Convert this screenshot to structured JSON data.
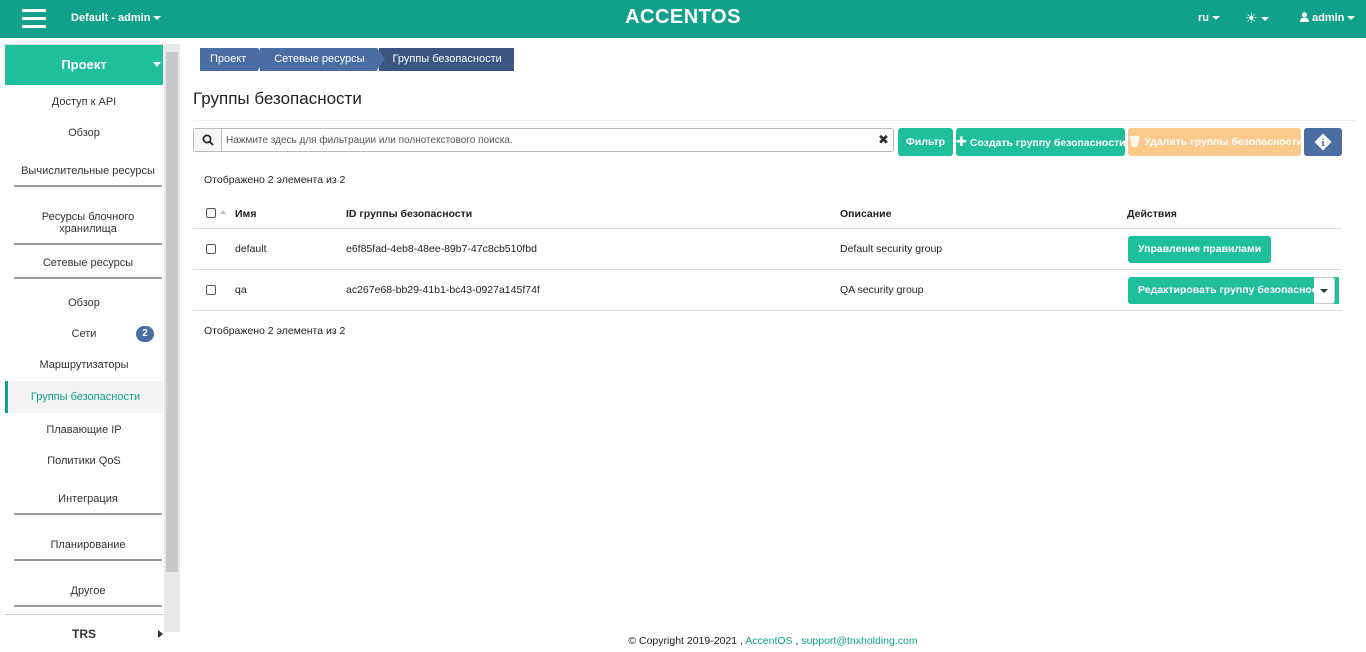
{
  "topbar": {
    "project_switch": "Default - admin",
    "logo": "ACCENTOS",
    "lang": "ru",
    "user": "admin"
  },
  "sidebar": {
    "project_header": "Проект",
    "api_access": "Доступ к API",
    "overview": "Обзор",
    "compute": "Вычислительные ресурсы",
    "block_storage": "Ресурсы блочного хранилища",
    "network": "Сетевые ресурсы",
    "network_items": {
      "overview": "Обзор",
      "networks": "Сети",
      "networks_badge": "2",
      "routers": "Маршрутизаторы",
      "security_groups": "Группы безопасности",
      "floating_ips": "Плавающие IP",
      "qos_policies": "Политики QoS"
    },
    "integration": "Интеграция",
    "planning": "Планирование",
    "other": "Другое",
    "trs": "TRS"
  },
  "breadcrumb": [
    "Проект",
    "Сетевые ресурсы",
    "Группы безопасности"
  ],
  "page_title": "Группы безопасности",
  "search": {
    "placeholder": "Нажмите здесь для фильтрации или полнотекстового поиска.",
    "clear": "✖"
  },
  "toolbar": {
    "filter": "Фильтр",
    "create": "Создать группу безопасности",
    "delete": "Удалить группы безопасности",
    "info": "i"
  },
  "count_text": "Отображено 2 элемента из 2",
  "table": {
    "headers": {
      "name": "Имя",
      "id": "ID группы безопасности",
      "description": "Описание",
      "actions": "Действия"
    },
    "rows": [
      {
        "name": "default",
        "id": "e6f85fad-4eb8-48ee-89b7-47c8cb510fbd",
        "description": "Default security group",
        "action": "Управление правилами"
      },
      {
        "name": "qa",
        "id": "ac267e68-bb29-41b1-bc43-0927a145f74f",
        "description": "QA security group",
        "action": "Редактировать группу безопасности"
      }
    ]
  },
  "footer": {
    "copyright": "© Copyright 2019-2021 ,",
    "product_link": "AccentOS",
    "separator": ",",
    "support_link": "support@tnxholding.com"
  },
  "colors": {
    "topbar": "#11a08a",
    "primary_green": "#1fbf9c",
    "blue": "#4a6ea3",
    "disabled_orange": "#fbc98a"
  }
}
